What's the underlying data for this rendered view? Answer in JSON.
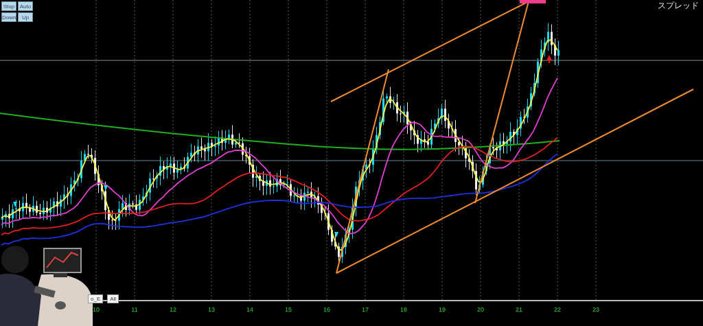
{
  "toolbar": {
    "buttons": [
      {
        "label": "Stop"
      },
      {
        "label": "Auto"
      },
      {
        "label": "Down"
      },
      {
        "label": "Up"
      }
    ]
  },
  "corner_label": "スプレッド",
  "chart_buttons": [
    {
      "label": "o_E"
    },
    {
      "label": "All"
    }
  ],
  "x_axis": {
    "labels": [
      "10",
      "11",
      "12",
      "13",
      "14",
      "15",
      "16",
      "17",
      "18",
      "19",
      "20",
      "21",
      "22",
      "23"
    ]
  }
}
